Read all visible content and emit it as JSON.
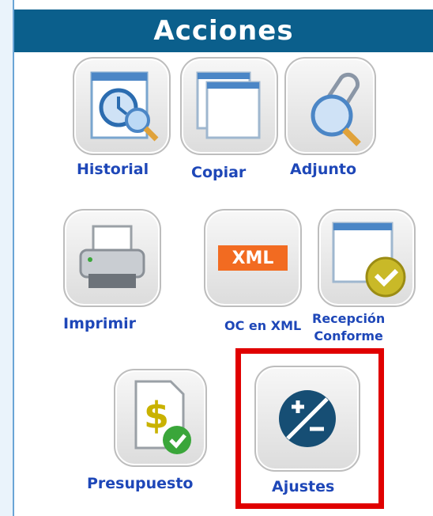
{
  "header": {
    "title": "Acciones"
  },
  "actions": [
    {
      "id": "historial",
      "label": "Historial",
      "icon": "history-search-icon"
    },
    {
      "id": "copiar",
      "label": "Copiar",
      "icon": "copy-icon"
    },
    {
      "id": "adjunto",
      "label": "Adjunto",
      "icon": "attachment-search-icon"
    },
    {
      "id": "imprimir",
      "label": "Imprimir",
      "icon": "printer-icon"
    },
    {
      "id": "oc_xml",
      "label": "OC en XML",
      "icon": "xml-icon",
      "icon_text": "XML"
    },
    {
      "id": "recepcion",
      "label": "Recepción Conforme",
      "label_lines": [
        "Recepción",
        "Conforme"
      ],
      "icon": "window-check-icon"
    },
    {
      "id": "presupuesto",
      "label": "Presupuesto",
      "icon": "budget-check-icon",
      "icon_text": "$"
    },
    {
      "id": "ajustes",
      "label": "Ajustes",
      "icon": "adjust-plus-minus-icon",
      "highlighted": true
    }
  ],
  "colors": {
    "header_bg": "#0b5f8c",
    "label_blue": "#1e47b8",
    "highlight_red": "#e00000",
    "xml_orange": "#f26b21",
    "check_green": "#3aa63a"
  }
}
